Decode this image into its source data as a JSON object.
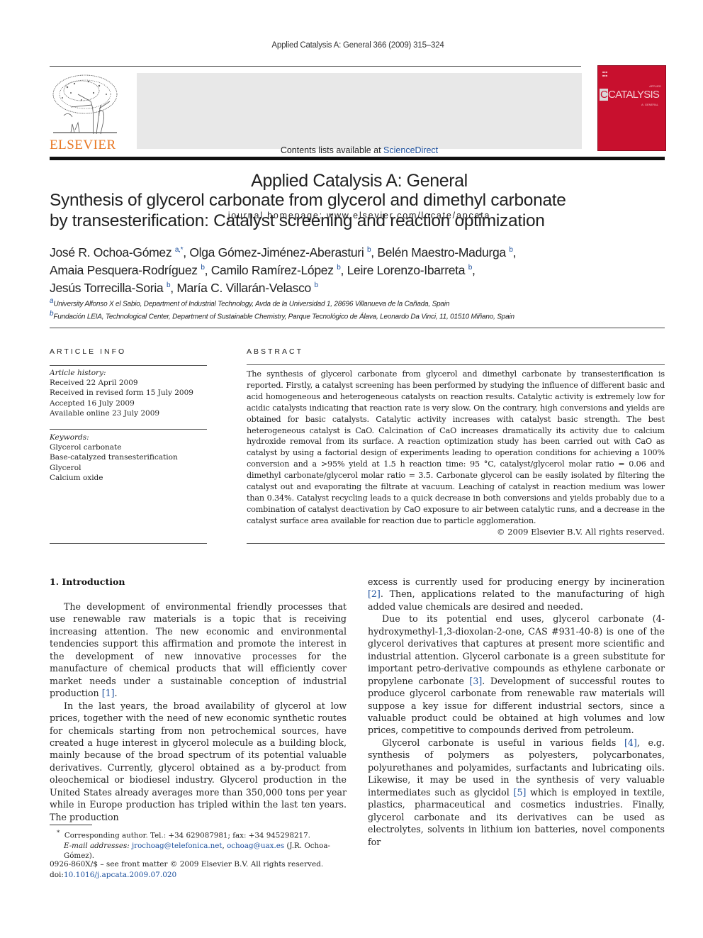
{
  "header": {
    "citation": "Applied Catalysis A: General 366 (2009) 315–324",
    "publisher_logo": "ELSEVIER",
    "contents_prefix": "Contents lists available at ",
    "contents_link": "ScienceDirect",
    "journal_title": "Applied Catalysis A: General",
    "homepage": "journal homepage: www.elsevier.com/locate/apcata",
    "cover": {
      "title_big": "CATALYSIS",
      "title_c": "C",
      "title_top": "APPLIED",
      "title_sub": "A: GENERAL",
      "color": "#c8102e"
    }
  },
  "article": {
    "title_line1": "Synthesis of glycerol carbonate from glycerol and dimethyl carbonate",
    "title_line2": "by transesterification: Catalyst screening and reaction optimization",
    "authors": [
      {
        "name": "José R. Ochoa-Gómez",
        "aff": "a,*",
        "sep": ", "
      },
      {
        "name": "Olga Gómez-Jiménez-Aberasturi",
        "aff": "b",
        "sep": ", "
      },
      {
        "name": "Belén Maestro-Madurga",
        "aff": "b",
        "sep": ","
      },
      {
        "name": "Amaia Pesquera-Rodríguez",
        "aff": "b",
        "sep": ", "
      },
      {
        "name": "Camilo Ramírez-López",
        "aff": "b",
        "sep": ", "
      },
      {
        "name": "Leire Lorenzo-Ibarreta",
        "aff": "b",
        "sep": ","
      },
      {
        "name": "Jesús Torrecilla-Soria",
        "aff": "b",
        "sep": ", "
      },
      {
        "name": "María C. Villarán-Velasco",
        "aff": "b",
        "sep": ""
      }
    ],
    "affiliations": [
      {
        "mark": "a",
        "text": "University Alfonso X el Sabio, Department of Industrial Technology, Avda de la Universidad 1, 28696 Villanueva de la Cañada, Spain"
      },
      {
        "mark": "b",
        "text": "Fundación LEIA, Technological Center, Department of Sustainable Chemistry, Parque Tecnológico de Álava, Leonardo Da Vinci, 11, 01510 Miñano, Spain"
      }
    ]
  },
  "article_info": {
    "heading": "ARTICLE INFO",
    "history_label": "Article history:",
    "history": [
      "Received 22 April 2009",
      "Received in revised form 15 July 2009",
      "Accepted 16 July 2009",
      "Available online 23 July 2009"
    ],
    "keywords_label": "Keywords:",
    "keywords": [
      "Glycerol carbonate",
      "Base-catalyzed transesterification",
      "Glycerol",
      "Calcium oxide"
    ]
  },
  "abstract": {
    "heading": "ABSTRACT",
    "text": "The synthesis of glycerol carbonate from glycerol and dimethyl carbonate by transesterification is reported. Firstly, a catalyst screening has been performed by studying the influence of different basic and acid homogeneous and heterogeneous catalysts on reaction results. Catalytic activity is extremely low for acidic catalysts indicating that reaction rate is very slow. On the contrary, high conversions and yields are obtained for basic catalysts. Catalytic activity increases with catalyst basic strength. The best heterogeneous catalyst is CaO. Calcination of CaO increases dramatically its activity due to calcium hydroxide removal from its surface. A reaction optimization study has been carried out with CaO as catalyst by using a factorial design of experiments leading to operation conditions for achieving a 100% conversion and a >95% yield at 1.5 h reaction time: 95 °C, catalyst/glycerol molar ratio = 0.06 and dimethyl carbonate/glycerol molar ratio = 3.5. Carbonate glycerol can be easily isolated by filtering the catalyst out and evaporating the filtrate at vacuum. Leaching of catalyst in reaction medium was lower than 0.34%. Catalyst recycling leads to a quick decrease in both conversions and yields probably due to a combination of catalyst deactivation by CaO exposure to air between catalytic runs, and a decrease in the catalyst surface area available for reaction due to particle agglomeration.",
    "copyright": "© 2009 Elsevier B.V. All rights reserved."
  },
  "body": {
    "section_heading": "1.  Introduction",
    "left_paragraphs": [
      {
        "text": "The development of environmental friendly processes that use renewable raw materials is a topic that is receiving increasing attention. The new economic and environmental tendencies support this affirmation and promote the interest in the development of new innovative processes for the manufacture of chemical products that will efficiently cover market needs under a sustainable conception of industrial production ",
        "ref": "[1]",
        "after": "."
      },
      {
        "text": "In the last years, the broad availability of glycerol at low prices, together with the need of new economic synthetic routes for chemicals starting from non petrochemical sources, have created a huge interest in glycerol molecule as a building block, mainly because of the broad spectrum of its potential valuable derivatives. Currently, glycerol obtained as a by-product from oleochemical or biodiesel industry. Glycerol production in the United States already averages more than 350,000 tons per year while in Europe production has tripled within the last ten years. The production",
        "ref": "",
        "after": ""
      }
    ],
    "right_paragraphs": [
      {
        "pre": "excess is currently used for producing energy by incineration ",
        "ref": "[2]",
        "post": ". Then, applications related to the manufacturing of high added value chemicals are desired and needed."
      },
      {
        "pre": "Due to its potential end uses, glycerol carbonate (4-hydroxymethyl-1,3-dioxolan-2-one, CAS #931-40-8) is one of the glycerol derivatives that captures at present more scientific and industrial attention. Glycerol carbonate is a green substitute for important petro-derivative compounds as ethylene carbonate or propylene carbonate ",
        "ref": "[3]",
        "post": ". Development of successful routes to produce glycerol carbonate from renewable raw materials will suppose a key issue for different industrial sectors, since a valuable product could be obtained at high volumes and low prices, competitive to compounds derived from petroleum."
      },
      {
        "pre": "Glycerol carbonate is useful in various fields ",
        "ref": "[4]",
        "post": ", e.g. synthesis of polymers as polyesters, polycarbonates, polyurethanes and polyamides, surfactants and lubricating oils. Likewise, it may be used in the synthesis of very valuable intermediates such as glycidol ",
        "ref2": "[5]",
        "post2": " which is employed in textile, plastics, pharmaceutical and cosmetics industries. Finally, glycerol carbonate and its derivatives can be used as electrolytes, solvents in lithium ion batteries, novel components for"
      }
    ]
  },
  "footnote": {
    "mark": "*",
    "corresponding": "Corresponding author. Tel.: +34 629087981; fax: +34 945298217.",
    "email_label": "E-mail addresses:",
    "email1": "jrochoag@telefonica.net",
    "email2": "ochoag@uax.es",
    "email_suffix": " (J.R. Ochoa-Gómez)."
  },
  "issn": {
    "line": "0926-860X/$ – see front matter © 2009 Elsevier B.V. All rights reserved.",
    "doi_prefix": "doi:",
    "doi": "10.1016/j.apcata.2009.07.020"
  },
  "colors": {
    "link": "#1c4f9c",
    "elsevier_orange": "#e87722",
    "banner_gray": "#e8e8e8",
    "cover_red": "#c8102e"
  }
}
